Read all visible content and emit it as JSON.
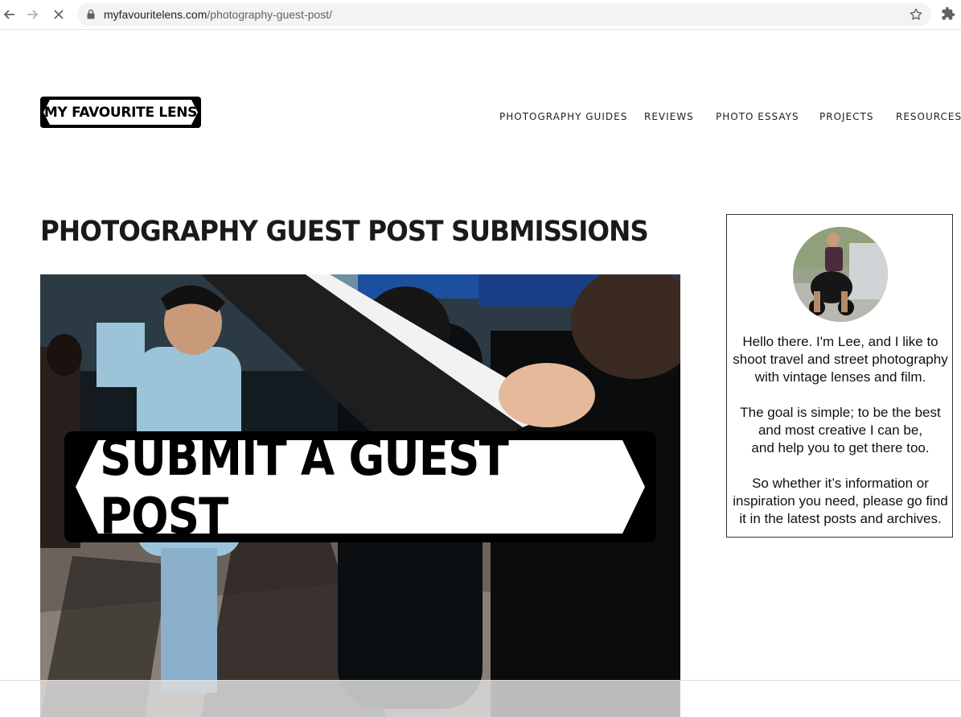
{
  "browser": {
    "url_domain": "myfavouritelens.com",
    "url_path": "/photography-guest-post/"
  },
  "site": {
    "logo_text": "MY FAVOURITE LENS",
    "nav": [
      "PHOTOGRAPHY GUIDES",
      "REVIEWS",
      "PHOTO ESSAYS",
      "PROJECTS",
      "RESOURCES"
    ]
  },
  "main": {
    "title": "PHOTOGRAPHY GUEST POST SUBMISSIONS",
    "hero_banner_text": "SUBMIT A GUEST POST"
  },
  "sidebar": {
    "bio": [
      "Hello there. I'm Lee, and I like to\nshoot travel and street photography\nwith vintage lenses and film.",
      "The goal is simple; to be the best\nand most creative I can be,\nand help you to get there too.",
      "So whether it’s information or\ninspiration you need, please go find\nit in the latest posts and archives."
    ]
  },
  "colors": {
    "text": "#111111",
    "omnibox_bg": "#f1f3f4",
    "sidebar_border": "#333333"
  },
  "icons": [
    "back-arrow-icon",
    "forward-arrow-icon",
    "stop-loading-icon",
    "lock-icon",
    "star-icon",
    "puzzle-icon"
  ]
}
